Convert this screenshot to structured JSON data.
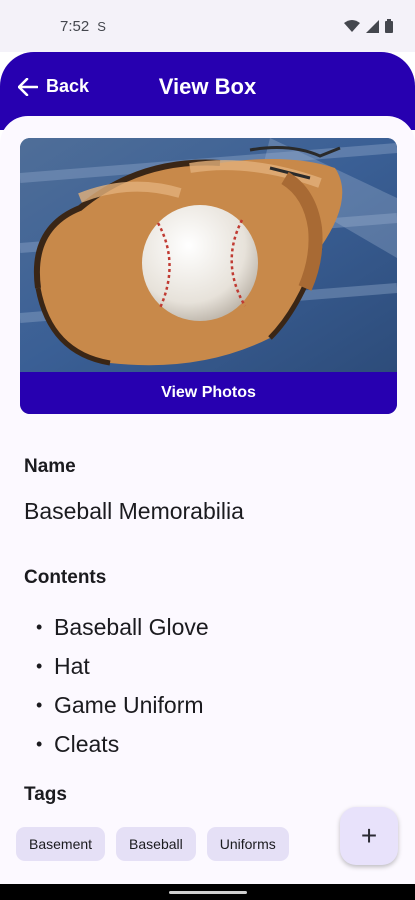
{
  "status_bar": {
    "time": "7:52",
    "notification_icon": "S"
  },
  "app_bar": {
    "back_label": "Back",
    "title": "View Box"
  },
  "photo": {
    "button_label": "View Photos",
    "subject": "baseball-in-glove-photo"
  },
  "name_section": {
    "label": "Name",
    "value": "Baseball Memorabilia"
  },
  "contents_section": {
    "label": "Contents",
    "items": [
      "Baseball Glove",
      "Hat",
      "Game Uniform",
      "Cleats"
    ]
  },
  "tags_section": {
    "label": "Tags",
    "chips": [
      "Basement",
      "Baseball",
      "Uniforms"
    ]
  },
  "fab": {
    "icon": "plus-icon",
    "glyph": "+"
  },
  "colors": {
    "primary": "#2700b0",
    "surface": "#fcf9ff",
    "chip": "#e5e0f6"
  }
}
